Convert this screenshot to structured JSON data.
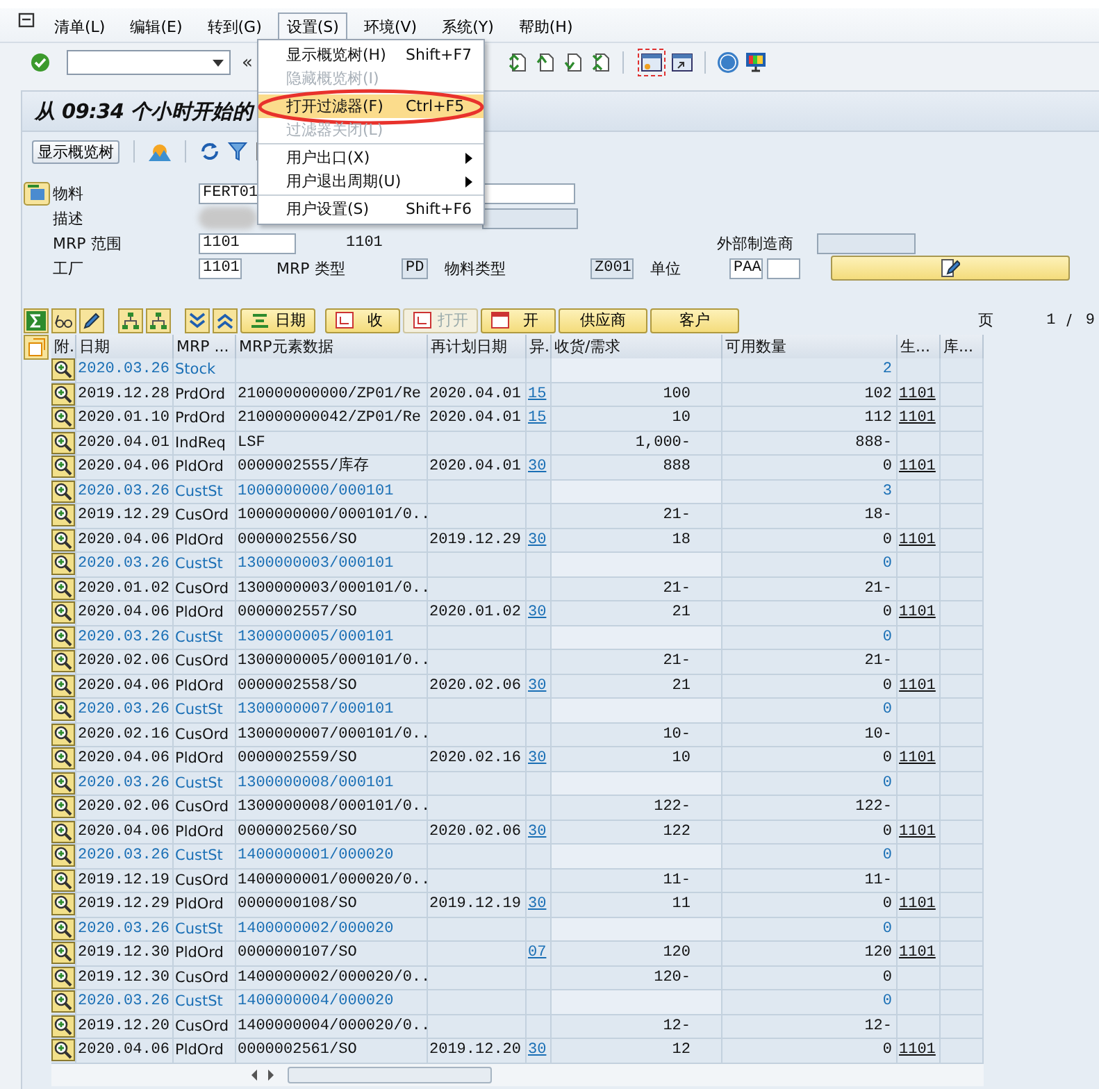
{
  "menu_bar": [
    {
      "label": "清单(L)",
      "selected": false
    },
    {
      "label": "编辑(E)",
      "selected": false
    },
    {
      "label": "转到(G)",
      "selected": false
    },
    {
      "label": "设置(S)",
      "selected": true
    },
    {
      "label": "环境(V)",
      "selected": false
    },
    {
      "label": "系统(Y)",
      "selected": false
    },
    {
      "label": "帮助(H)",
      "selected": false
    }
  ],
  "settings_menu": {
    "groups": [
      [
        {
          "label": "显示概览树(H)",
          "shortcut": "Shift+F7",
          "disabled": false,
          "selected": false,
          "submenu": false
        },
        {
          "label": "隐藏概览树(I)",
          "disabled": true,
          "selected": false,
          "submenu": false
        }
      ],
      [
        {
          "label": "打开过滤器(F)",
          "shortcut": "Ctrl+F5",
          "disabled": false,
          "selected": true,
          "submenu": false
        },
        {
          "label": "过滤器关闭(L)",
          "disabled": true,
          "selected": false,
          "submenu": false
        }
      ],
      [
        {
          "label": "用户出口(X)",
          "disabled": false,
          "selected": false,
          "submenu": true
        },
        {
          "label": "用户退出周期(U)",
          "disabled": false,
          "selected": false,
          "submenu": true
        }
      ],
      [
        {
          "label": "用户设置(S)",
          "shortcut": "Shift+F6",
          "disabled": false,
          "selected": false,
          "submenu": false
        }
      ]
    ]
  },
  "toolbar": {
    "history_button": "«"
  },
  "title": "从 09:34 个小时开始的",
  "app_toolbar": {
    "overview_button": "显示概览树"
  },
  "header": {
    "material": {
      "label": "物料",
      "value": "FERT01"
    },
    "description": {
      "label": "描述"
    },
    "mrp_area": {
      "label": "MRP 范围",
      "value": "1101",
      "text": "1101"
    },
    "external_manufacturer": {
      "label": "外部制造商"
    },
    "plant": {
      "label": "工厂",
      "value": "1101"
    },
    "mrp_type": {
      "label": "MRP 类型",
      "value": "PD"
    },
    "material_type": {
      "label": "物料类型",
      "value": "Z001"
    },
    "unit": {
      "label": "单位",
      "value": "PAA"
    }
  },
  "table_toolbar": {
    "buttons": [
      {
        "label": "日期",
        "disabled": false
      },
      {
        "label": "收",
        "disabled": false
      },
      {
        "label": "打开",
        "disabled": true
      },
      {
        "label": "开",
        "disabled": false
      },
      {
        "label": "供应商",
        "disabled": false
      },
      {
        "label": "客户",
        "disabled": false
      }
    ],
    "page_label": "页",
    "page": "1",
    "page_separator": "/",
    "page_count": "9"
  },
  "table": {
    "columns": [
      "附.",
      "日期",
      "MRP ...",
      "MRP元素数据",
      "再计划日期",
      "异.",
      "收货/需求",
      "可用数量",
      "生...",
      "库..."
    ],
    "rows": [
      {
        "kind": "total",
        "date": "2020.03.26",
        "mrp": "Stock",
        "available": "2"
      },
      {
        "kind": "item",
        "date": "2019.12.28",
        "mrp": "PrdOrd",
        "element": "210000000000/ZP01/Re",
        "reschedule": "2020.04.01",
        "exception": "15",
        "receipt": "100",
        "available": "102",
        "plant": "1101"
      },
      {
        "kind": "item",
        "date": "2020.01.10",
        "mrp": "PrdOrd",
        "element": "210000000042/ZP01/Re",
        "reschedule": "2020.04.01",
        "exception": "15",
        "receipt": "10",
        "available": "112",
        "plant": "1101"
      },
      {
        "kind": "item",
        "date": "2020.04.01",
        "mrp": "IndReq",
        "element": "LSF",
        "receipt": "1,000-",
        "available": "888-"
      },
      {
        "kind": "item",
        "date": "2020.04.06",
        "mrp": "PldOrd",
        "element": "0000002555/库存",
        "reschedule": "2020.04.01",
        "exception": "30",
        "receipt": "888",
        "available": "0",
        "plant": "1101"
      },
      {
        "kind": "total",
        "date": "2020.03.26",
        "mrp": "CustSt",
        "element": "1000000000/000101",
        "available": "3"
      },
      {
        "kind": "item",
        "date": "2019.12.29",
        "mrp": "CusOrd",
        "element": "1000000000/000101/0..",
        "receipt": "21-",
        "available": "18-"
      },
      {
        "kind": "item",
        "date": "2020.04.06",
        "mrp": "PldOrd",
        "element": "0000002556/SO",
        "reschedule": "2019.12.29",
        "exception": "30",
        "receipt": "18",
        "available": "0",
        "plant": "1101"
      },
      {
        "kind": "total",
        "date": "2020.03.26",
        "mrp": "CustSt",
        "element": "1300000003/000101",
        "available": "0"
      },
      {
        "kind": "item",
        "date": "2020.01.02",
        "mrp": "CusOrd",
        "element": "1300000003/000101/0..",
        "receipt": "21-",
        "available": "21-"
      },
      {
        "kind": "item",
        "date": "2020.04.06",
        "mrp": "PldOrd",
        "element": "0000002557/SO",
        "reschedule": "2020.01.02",
        "exception": "30",
        "receipt": "21",
        "available": "0",
        "plant": "1101"
      },
      {
        "kind": "total",
        "date": "2020.03.26",
        "mrp": "CustSt",
        "element": "1300000005/000101",
        "available": "0"
      },
      {
        "kind": "item",
        "date": "2020.02.06",
        "mrp": "CusOrd",
        "element": "1300000005/000101/0..",
        "receipt": "21-",
        "available": "21-"
      },
      {
        "kind": "item",
        "date": "2020.04.06",
        "mrp": "PldOrd",
        "element": "0000002558/SO",
        "reschedule": "2020.02.06",
        "exception": "30",
        "receipt": "21",
        "available": "0",
        "plant": "1101"
      },
      {
        "kind": "total",
        "date": "2020.03.26",
        "mrp": "CustSt",
        "element": "1300000007/000101",
        "available": "0"
      },
      {
        "kind": "item",
        "date": "2020.02.16",
        "mrp": "CusOrd",
        "element": "1300000007/000101/0..",
        "receipt": "10-",
        "available": "10-"
      },
      {
        "kind": "item",
        "date": "2020.04.06",
        "mrp": "PldOrd",
        "element": "0000002559/SO",
        "reschedule": "2020.02.16",
        "exception": "30",
        "receipt": "10",
        "available": "0",
        "plant": "1101"
      },
      {
        "kind": "total",
        "date": "2020.03.26",
        "mrp": "CustSt",
        "element": "1300000008/000101",
        "available": "0"
      },
      {
        "kind": "item",
        "date": "2020.02.06",
        "mrp": "CusOrd",
        "element": "1300000008/000101/0..",
        "receipt": "122-",
        "available": "122-"
      },
      {
        "kind": "item",
        "date": "2020.04.06",
        "mrp": "PldOrd",
        "element": "0000002560/SO",
        "reschedule": "2020.02.06",
        "exception": "30",
        "receipt": "122",
        "available": "0",
        "plant": "1101"
      },
      {
        "kind": "total",
        "date": "2020.03.26",
        "mrp": "CustSt",
        "element": "1400000001/000020",
        "available": "0"
      },
      {
        "kind": "item",
        "date": "2019.12.19",
        "mrp": "CusOrd",
        "element": "1400000001/000020/0..",
        "receipt": "11-",
        "available": "11-"
      },
      {
        "kind": "item",
        "date": "2019.12.29",
        "mrp": "PldOrd",
        "element": "0000000108/SO",
        "reschedule": "2019.12.19",
        "exception": "30",
        "receipt": "11",
        "available": "0",
        "plant": "1101"
      },
      {
        "kind": "total",
        "date": "2020.03.26",
        "mrp": "CustSt",
        "element": "1400000002/000020",
        "available": "0"
      },
      {
        "kind": "item",
        "date": "2019.12.30",
        "mrp": "PldOrd",
        "element": "0000000107/SO",
        "exception": "07",
        "receipt": "120",
        "available": "120",
        "plant": "1101"
      },
      {
        "kind": "item",
        "date": "2019.12.30",
        "mrp": "CusOrd",
        "element": "1400000002/000020/0..",
        "receipt": "120-",
        "available": "0"
      },
      {
        "kind": "total",
        "date": "2020.03.26",
        "mrp": "CustSt",
        "element": "1400000004/000020",
        "available": "0"
      },
      {
        "kind": "item",
        "date": "2019.12.20",
        "mrp": "CusOrd",
        "element": "1400000004/000020/0..",
        "receipt": "12-",
        "available": "12-"
      },
      {
        "kind": "item",
        "date": "2020.04.06",
        "mrp": "PldOrd",
        "element": "0000002561/SO",
        "reschedule": "2019.12.20",
        "exception": "30",
        "receipt": "12",
        "available": "0",
        "plant": "1101"
      }
    ]
  }
}
